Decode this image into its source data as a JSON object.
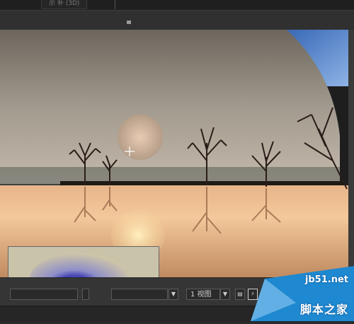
{
  "topbar": {
    "tab_label": "示 补 (3D)"
  },
  "viewport": {
    "cursor_icon": "move-cursor-icon"
  },
  "toolbar": {
    "view_count_label": "1 视图",
    "field_left": "",
    "field_middle": ""
  },
  "watermark": {
    "url": "jb51.net",
    "text": "脚本之家"
  },
  "colors": {
    "accent_blue": "#1e88d0",
    "sky_blue": "#4a7fc8",
    "toolbar_bg": "#353535"
  }
}
